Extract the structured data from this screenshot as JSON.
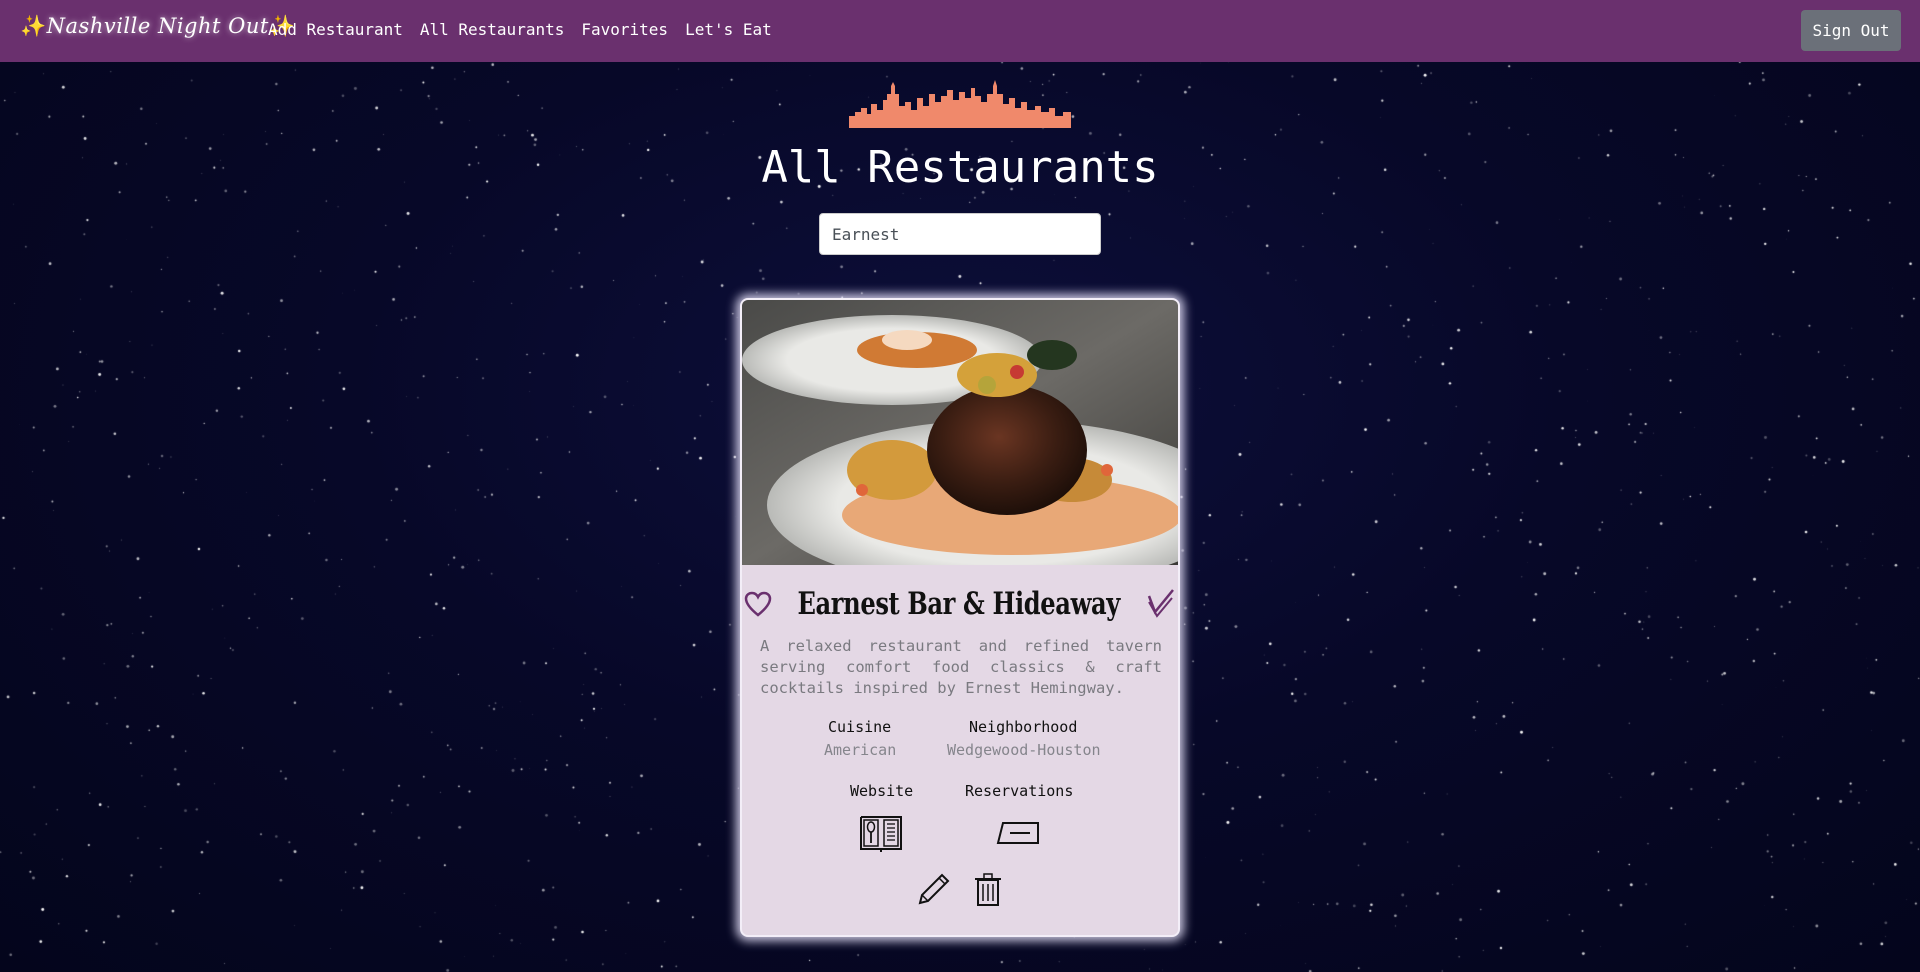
{
  "navbar": {
    "brand": "Nashville Night Out",
    "brand_spark": "✨",
    "links": [
      "Add Restaurant",
      "All Restaurants",
      "Favorites",
      "Let's Eat"
    ],
    "sign_out": "Sign Out",
    "bg_color": "#6a306e"
  },
  "page": {
    "title": "All Restaurants",
    "skyline_icon": "nashville-skyline",
    "skyline_color": "#f0896b"
  },
  "search": {
    "value": "Earnest"
  },
  "restaurant": {
    "name": "Earnest Bar & Hideaway",
    "description": "A relaxed restaurant and refined tavern serving comfort food classics & craft cocktails inspired by Ernest Hemingway.",
    "cuisine_label": "Cuisine",
    "cuisine": "American",
    "neighborhood_label": "Neighborhood",
    "neighborhood": "Wedgewood-Houston",
    "website_label": "Website",
    "reservations_label": "Reservations",
    "icons": [
      "heart-icon",
      "check-icon",
      "menu-icon",
      "reservation-ticket-icon",
      "pencil-icon",
      "trash-icon"
    ],
    "accent_color": "#6a306e",
    "card_bg": "#e4d8e5"
  }
}
